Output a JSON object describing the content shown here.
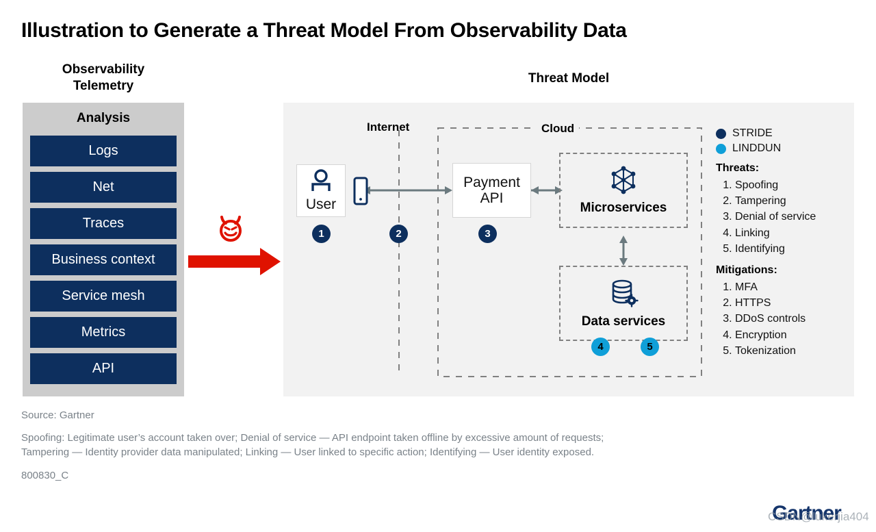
{
  "title": "Illustration to Generate a Threat Model From Observability Data",
  "observability": {
    "heading_line1": "Observability",
    "heading_line2": "Telemetry",
    "panel_title": "Analysis",
    "items": [
      {
        "label": "Logs"
      },
      {
        "label": "Net"
      },
      {
        "label": "Traces"
      },
      {
        "label": "Business context"
      },
      {
        "label": "Service mesh"
      },
      {
        "label": "Metrics"
      },
      {
        "label": "API"
      }
    ]
  },
  "transform": {
    "devil_icon": "devil-face-icon",
    "arrow_icon": "right-arrow-icon",
    "arrow_color": "#df1200"
  },
  "threat_model": {
    "heading": "Threat Model",
    "zones": [
      {
        "name": "internet",
        "label": "Internet"
      },
      {
        "name": "cloud",
        "label": "Cloud"
      }
    ],
    "nodes": [
      {
        "name": "user",
        "label": "User",
        "icon": "person-icon"
      },
      {
        "name": "mobile",
        "label": "",
        "icon": "mobile-phone-icon"
      },
      {
        "name": "payment-api",
        "label_line1": "Payment",
        "label_line2": "API"
      },
      {
        "name": "microservices",
        "label": "Microservices",
        "icon": "network-graph-icon"
      },
      {
        "name": "data-services",
        "label": "Data services",
        "icon": "database-gear-icon"
      }
    ],
    "markers": [
      {
        "id": "1",
        "type": "stride"
      },
      {
        "id": "2",
        "type": "stride"
      },
      {
        "id": "3",
        "type": "stride"
      },
      {
        "id": "4",
        "type": "linddun"
      },
      {
        "id": "5",
        "type": "linddun"
      }
    ]
  },
  "legend": {
    "entries": [
      {
        "label": "STRIDE",
        "color": "#0d2f5e"
      },
      {
        "label": "LINDDUN",
        "color": "#0f9fd8"
      }
    ],
    "threats_heading": "Threats:",
    "threats": [
      "Spoofing",
      "Tampering",
      "Denial of service",
      "Linking",
      "Identifying"
    ],
    "mitigations_heading": "Mitigations:",
    "mitigations": [
      "MFA",
      "HTTPS",
      "DDoS controls",
      "Encryption",
      "Tokenization"
    ]
  },
  "footer": {
    "source": "Source: Gartner",
    "note_line1": "Spoofing: Legitimate user’s account taken over; Denial of service — API endpoint taken offline by excessive amount of requests;",
    "note_line2": "Tampering — Identity provider data manipulated; Linking — User linked to specific action; Identifying — User identity exposed.",
    "code": "800830_C",
    "logo": "Gartner",
    "watermark": "CSDN@lukerjia404"
  }
}
